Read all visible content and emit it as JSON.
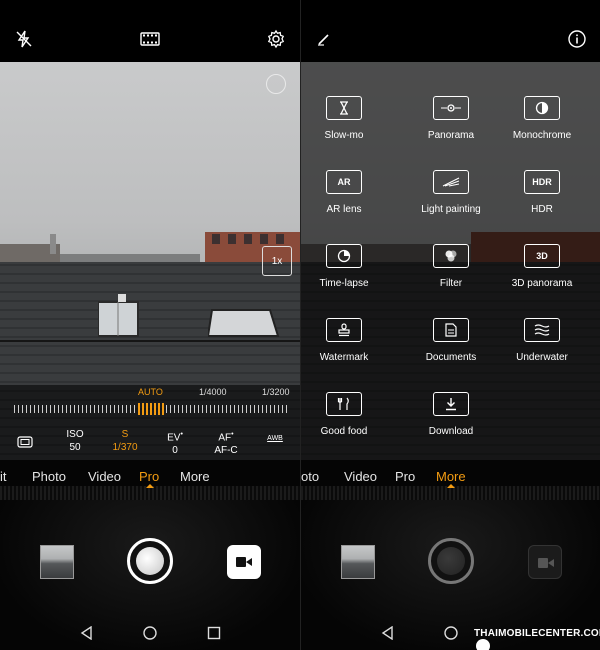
{
  "colors": {
    "accent": "#f39c12",
    "background": "#000000",
    "text": "#ffffff"
  },
  "left": {
    "topbar": {
      "flash_icon": "flash-off-icon",
      "mode_icon": "film-icon",
      "settings_icon": "gear-icon"
    },
    "zoom_label": "1x",
    "pro_scale": {
      "labels": [
        "AUTO",
        "1/4000",
        "1/3200"
      ]
    },
    "params": [
      {
        "label": "ISO",
        "value": "50"
      },
      {
        "label": "S",
        "value": "1/370"
      },
      {
        "label": "EV",
        "value": "0"
      },
      {
        "label": "AF",
        "value": "AF-C"
      },
      {
        "label": "AWB",
        "value": ""
      }
    ],
    "modes": [
      "it",
      "Photo",
      "Video",
      "Pro",
      "More"
    ],
    "active_mode": "Pro"
  },
  "right": {
    "topbar": {
      "edit_icon": "pencil-icon",
      "info_icon": "info-icon"
    },
    "more_modes": [
      {
        "label": "Slow-mo",
        "icon": "hourglass-icon"
      },
      {
        "label": "Panorama",
        "icon": "panorama-icon"
      },
      {
        "label": "Monochrome",
        "icon": "monochrome-icon"
      },
      {
        "label": "AR lens",
        "icon": "ar-lens-icon",
        "badge": "AR"
      },
      {
        "label": "Light painting",
        "icon": "light-painting-icon"
      },
      {
        "label": "HDR",
        "icon": "hdr-icon",
        "badge": "HDR"
      },
      {
        "label": "Time-lapse",
        "icon": "time-lapse-icon"
      },
      {
        "label": "Filter",
        "icon": "filter-icon"
      },
      {
        "label": "3D panorama",
        "icon": "3d-panorama-icon",
        "badge": "3D"
      },
      {
        "label": "Watermark",
        "icon": "watermark-icon"
      },
      {
        "label": "Documents",
        "icon": "documents-icon"
      },
      {
        "label": "Underwater",
        "icon": "underwater-icon"
      },
      {
        "label": "Good food",
        "icon": "good-food-icon"
      },
      {
        "label": "Download",
        "icon": "download-icon"
      }
    ],
    "modes": [
      "oto",
      "Video",
      "Pro",
      "More"
    ],
    "active_mode": "More"
  },
  "watermark": "THAIMOBILECENTER.COM"
}
